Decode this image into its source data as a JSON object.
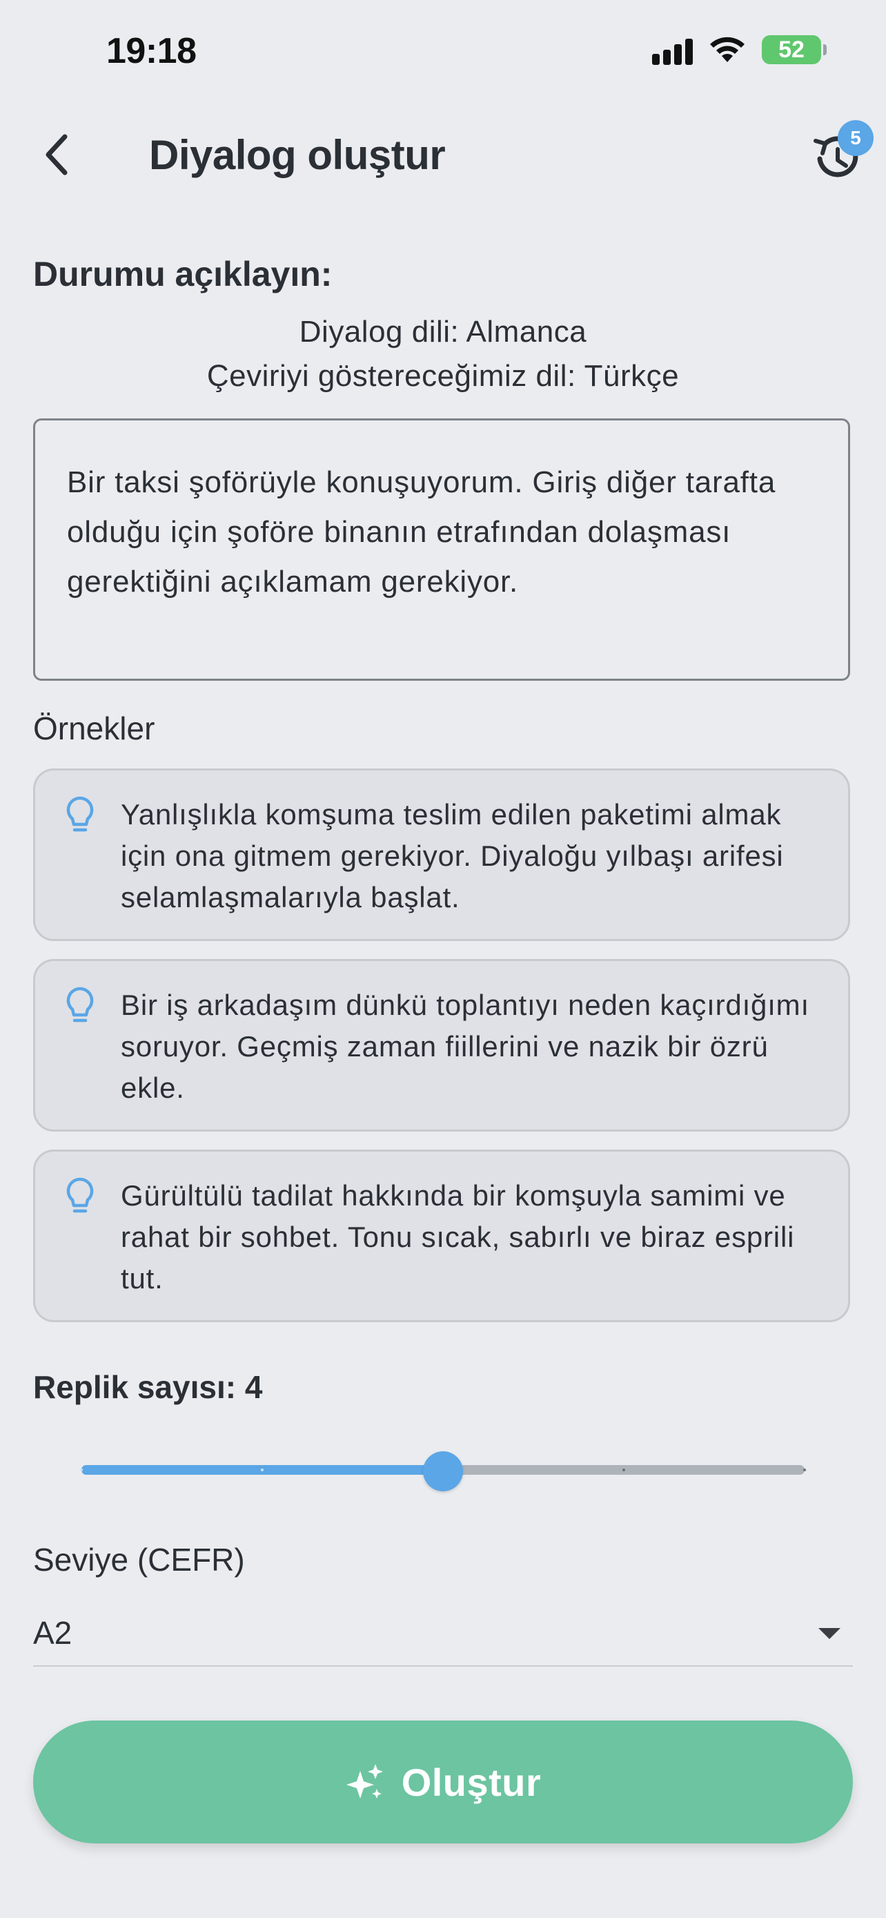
{
  "status_bar": {
    "time": "19:18",
    "battery": "52"
  },
  "header": {
    "title": "Diyalog oluştur",
    "history_badge": "5"
  },
  "situation": {
    "label": "Durumu açıklayın:",
    "dialog_language": "Diyalog dili: Almanca",
    "translation_language": "Çeviriyi göstereceğimiz dil: Türkçe",
    "text": "Bir taksi şoförüyle konuşuyorum. Giriş diğer tarafta olduğu için şoföre binanın etrafından dolaşması gerektiğini açıklamam gerekiyor."
  },
  "examples": {
    "label": "Örnekler",
    "items": [
      {
        "icon": "lightbulb-icon",
        "text": "Yanlışlıkla komşuma teslim edilen paketimi almak için ona gitmem gerekiyor. Diyaloğu yılbaşı arifesi selamlaşmalarıyla başlat."
      },
      {
        "icon": "lightbulb-icon",
        "text": "Bir iş arkadaşım dünkü toplantıyı neden kaçırdığımı soruyor. Geçmiş zaman fiillerini ve nazik bir özrü ekle."
      },
      {
        "icon": "lightbulb-icon",
        "text": "Gürültülü tadilat hakkında bir komşuyla samimi ve rahat bir sohbet. Tonu sıcak, sabırlı ve biraz esprili tut."
      }
    ]
  },
  "replik": {
    "label": "Replik sayısı: 4",
    "value": 4,
    "min": 2,
    "max": 6,
    "step": 1
  },
  "level": {
    "label": "Seviye (CEFR)",
    "selected": "A2"
  },
  "create_button": {
    "label": "Oluştur",
    "icon": "sparkles-icon"
  },
  "colors": {
    "accent": "#5aa6e6",
    "primary_button": "#6cc4a1",
    "background": "#eaecef",
    "card": "#dfe1e6"
  }
}
